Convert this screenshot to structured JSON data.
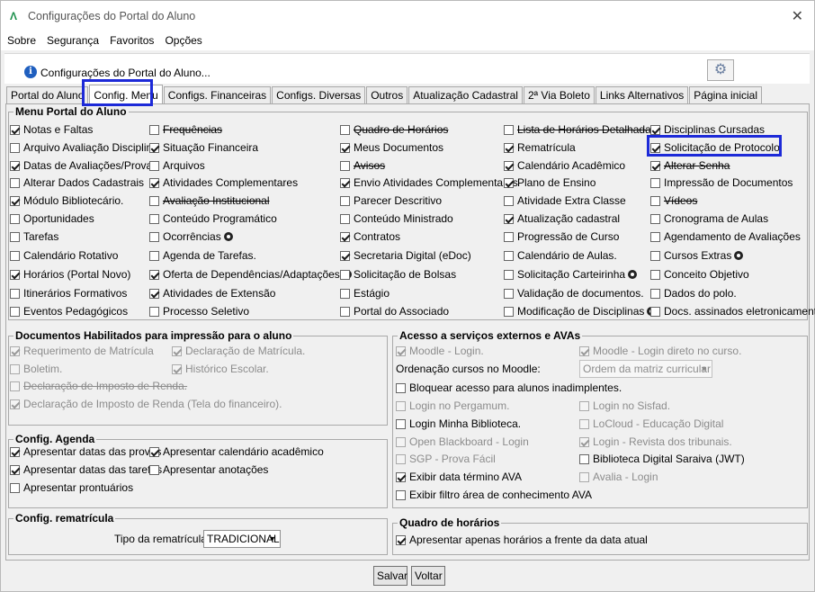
{
  "window": {
    "title": "Configurações do Portal do Aluno"
  },
  "menubar": [
    "Sobre",
    "Segurança",
    "Favoritos",
    "Opções"
  ],
  "info": {
    "text": "Configurações do Portal do Aluno..."
  },
  "tabs": [
    "Portal do Aluno",
    "Config. Menu",
    "Configs. Financeiras",
    "Configs. Diversas",
    "Outros",
    "Atualização Cadastral",
    "2ª Via Boleto",
    "Links Alternativos",
    "Página inicial"
  ],
  "menu_group": {
    "title": "Menu Portal do Aluno",
    "col1": [
      {
        "label": "Notas e Faltas",
        "checked": true
      },
      {
        "label": "Arquivo Avaliação Disciplina",
        "checked": false
      },
      {
        "label": "Datas de Avaliações/Provas",
        "checked": true
      },
      {
        "label": "Alterar Dados Cadastrais",
        "checked": false
      },
      {
        "label": "Módulo Bibliotecário.",
        "checked": true
      },
      {
        "label": "Oportunidades",
        "checked": false
      },
      {
        "label": "Tarefas",
        "checked": false
      },
      {
        "label": "Calendário Rotativo",
        "checked": false
      },
      {
        "label": "Horários (Portal Novo)",
        "checked": true
      },
      {
        "label": "Itinerários Formativos",
        "checked": false
      },
      {
        "label": "Eventos Pedagógicos",
        "checked": false
      }
    ],
    "col2": [
      {
        "label": "Frequências",
        "checked": false
      },
      {
        "label": "Situação Financeira",
        "checked": true
      },
      {
        "label": "Arquivos",
        "checked": false
      },
      {
        "label": "Atividades Complementares",
        "checked": true
      },
      {
        "label": "Avaliação Institucional",
        "checked": false
      },
      {
        "label": "Conteúdo Programático",
        "checked": false
      },
      {
        "label": "Ocorrências",
        "checked": false
      },
      {
        "label": "Agenda de Tarefas.",
        "checked": false
      },
      {
        "label": "Oferta de Dependências/Adaptações",
        "checked": true
      },
      {
        "label": "Atividades de Extensão",
        "checked": true
      },
      {
        "label": "Processo Seletivo",
        "checked": false
      }
    ],
    "col3": [
      {
        "label": "Quadro de Horários",
        "checked": false
      },
      {
        "label": "Meus Documentos",
        "checked": true
      },
      {
        "label": "Avisos",
        "checked": false
      },
      {
        "label": "Envio Atividades Complementares",
        "checked": true
      },
      {
        "label": "Parecer Descritivo",
        "checked": false
      },
      {
        "label": "Conteúdo Ministrado",
        "checked": false
      },
      {
        "label": "Contratos",
        "checked": true
      },
      {
        "label": "Secretaria Digital (eDoc)",
        "checked": true
      },
      {
        "label": "Solicitação de Bolsas",
        "checked": false
      },
      {
        "label": "Estágio",
        "checked": false
      },
      {
        "label": "Portal do Associado",
        "checked": false
      }
    ],
    "col4": [
      {
        "label": "Lista de Horários Detalhada",
        "checked": false
      },
      {
        "label": "Rematrícula",
        "checked": true
      },
      {
        "label": "Calendário Acadêmico",
        "checked": true
      },
      {
        "label": "Plano de Ensino",
        "checked": true
      },
      {
        "label": "Atividade Extra Classe",
        "checked": false
      },
      {
        "label": "Atualização cadastral",
        "checked": true
      },
      {
        "label": "Progressão de Curso",
        "checked": false
      },
      {
        "label": "Calendário de Aulas.",
        "checked": false
      },
      {
        "label": "Solicitação Carteirinha",
        "checked": false
      },
      {
        "label": "Validação de documentos.",
        "checked": false
      },
      {
        "label": "Modificação de Disciplinas",
        "checked": false
      }
    ],
    "col5": [
      {
        "label": "Disciplinas Cursadas",
        "checked": true
      },
      {
        "label": "Solicitação de Protocolo",
        "checked": true
      },
      {
        "label": "Alterar Senha",
        "checked": true
      },
      {
        "label": "Impressão de Documentos",
        "checked": false
      },
      {
        "label": "Vídeos",
        "checked": false
      },
      {
        "label": "Cronograma de Aulas",
        "checked": false
      },
      {
        "label": "Agendamento de Avaliações",
        "checked": false
      },
      {
        "label": "Cursos Extras",
        "checked": false
      },
      {
        "label": "Conceito Objetivo",
        "checked": false
      },
      {
        "label": "Dados do polo.",
        "checked": false
      },
      {
        "label": "Docs. assinados eletronicamente.",
        "checked": false
      }
    ]
  },
  "docs_group": {
    "title": "Documentos Habilitados para impressão para o aluno",
    "items": [
      {
        "label": "Requerimento de Matrícula",
        "checked": true
      },
      {
        "label": "Declaração de Matrícula.",
        "checked": true
      },
      {
        "label": "Boletim.",
        "checked": false
      },
      {
        "label": "Histórico Escolar.",
        "checked": true
      },
      {
        "label": "Declaração de Imposto de Renda.",
        "checked": false
      },
      {
        "label": "Declaração de Imposto de Renda (Tela do financeiro).",
        "checked": true
      }
    ]
  },
  "agenda_group": {
    "title": "Config. Agenda",
    "items": [
      {
        "label": "Apresentar datas das provas",
        "checked": true
      },
      {
        "label": "Apresentar calendário acadêmico",
        "checked": true
      },
      {
        "label": "Apresentar datas das tarefas",
        "checked": true
      },
      {
        "label": "Apresentar anotações",
        "checked": false
      },
      {
        "label": "Apresentar prontuários",
        "checked": false
      }
    ]
  },
  "rematricula_group": {
    "title": "Config. rematrícula",
    "label": "Tipo da rematrícula:",
    "value": "TRADICIONAL"
  },
  "external_group": {
    "title": "Acesso a serviços externos e AVAs",
    "moodle_login": {
      "label": "Moodle - Login.",
      "checked": true
    },
    "moodle_direct": {
      "label": "Moodle - Login direto no curso.",
      "checked": true
    },
    "order_label": "Ordenação cursos no Moodle:",
    "order_value": "Ordem da matriz curricular",
    "block": {
      "label": "Bloquear acesso para alunos inadimplentes.",
      "checked": false
    },
    "pergamum": {
      "label": "Login no Pergamum.",
      "checked": false
    },
    "sisfad": {
      "label": "Login no Sisfad.",
      "checked": false
    },
    "minha_bib": {
      "label": "Login Minha Biblioteca.",
      "checked": false
    },
    "locloud": {
      "label": "LoCloud - Educação Digital",
      "checked": false
    },
    "blackboard": {
      "label": "Open Blackboard - Login",
      "checked": false
    },
    "tribunais": {
      "label": "Login - Revista dos tribunais.",
      "checked": true
    },
    "sgp": {
      "label": "SGP - Prova Fácil",
      "checked": false
    },
    "saraiva": {
      "label": "Biblioteca Digital Saraiva (JWT)",
      "checked": false
    },
    "exibir_data": {
      "label": "Exibir data término AVA",
      "checked": true
    },
    "avalia": {
      "label": "Avalia - Login",
      "checked": false
    },
    "exibir_filtro": {
      "label": "Exibir filtro área de conhecimento AVA",
      "checked": false
    }
  },
  "schedule_group": {
    "title": "Quadro de horários",
    "item": {
      "label": "Apresentar apenas horários a frente da data atual",
      "checked": true
    }
  },
  "buttons": {
    "save": "Salvar",
    "back": "Voltar"
  }
}
